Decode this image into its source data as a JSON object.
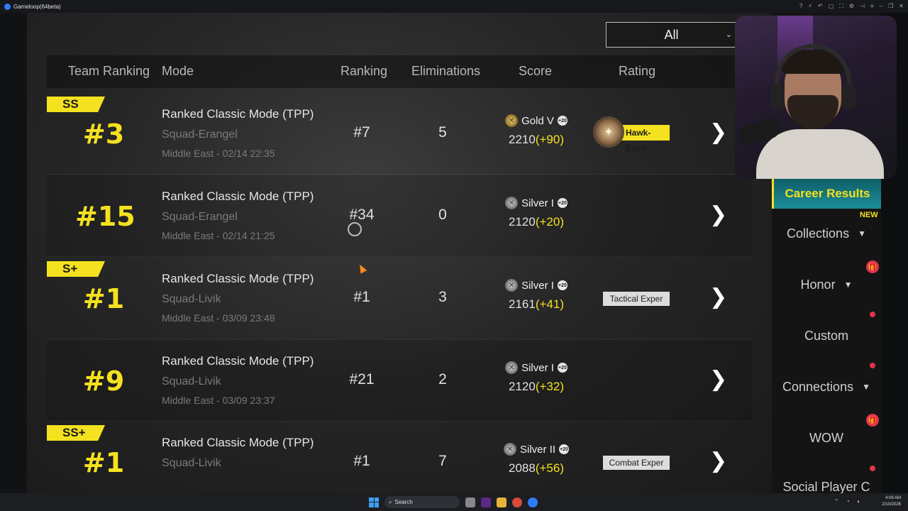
{
  "window": {
    "title": "Gameloop(64beta)"
  },
  "filter": {
    "label": "All"
  },
  "columns": [
    "Team Ranking",
    "Mode",
    "Ranking",
    "Eliminations",
    "Score",
    "Rating"
  ],
  "matches": [
    {
      "grade": "SS",
      "team_rank": "#3",
      "mode": "Ranked Classic Mode (TPP)",
      "map": "Squad-Erangel",
      "date": "Middle East - 02/14 22:35",
      "ranking": "#7",
      "elims": "5",
      "tier": "Gold V",
      "tier_plus": "+20",
      "score": "2210",
      "delta": "(+90)",
      "rating": "Hawk-Eyed",
      "rating_style": "gold"
    },
    {
      "grade": "",
      "team_rank": "#15",
      "mode": "Ranked Classic Mode (TPP)",
      "map": "Squad-Erangel",
      "date": "Middle East - 02/14 21:25",
      "ranking": "#34",
      "elims": "0",
      "tier": "Silver I",
      "tier_plus": "+20",
      "score": "2120",
      "delta": "(+20)",
      "rating": "",
      "rating_style": "none"
    },
    {
      "grade": "S+",
      "team_rank": "#1",
      "mode": "Ranked Classic Mode (TPP)",
      "map": "Squad-Livik",
      "date": "Middle East - 03/09 23:48",
      "ranking": "#1",
      "elims": "3",
      "tier": "Silver I",
      "tier_plus": "+20",
      "score": "2161",
      "delta": "(+41)",
      "rating": "Tactical Exper",
      "rating_style": "tag"
    },
    {
      "grade": "",
      "team_rank": "#9",
      "mode": "Ranked Classic Mode (TPP)",
      "map": "Squad-Livik",
      "date": "Middle East - 03/09 23:37",
      "ranking": "#21",
      "elims": "2",
      "tier": "Silver I",
      "tier_plus": "+20",
      "score": "2120",
      "delta": "(+32)",
      "rating": "",
      "rating_style": "none"
    },
    {
      "grade": "SS+",
      "team_rank": "#1",
      "mode": "Ranked Classic Mode (TPP)",
      "map": "Squad-Livik",
      "date": "",
      "ranking": "#1",
      "elims": "7",
      "tier": "Silver II",
      "tier_plus": "+20",
      "score": "2088",
      "delta": "(+56)",
      "rating": "Combat Exper",
      "rating_style": "tag"
    }
  ],
  "sidebar": {
    "active": "Career Results",
    "new_badge": "NEW",
    "items": [
      {
        "label": "Collections",
        "has_arrow": true
      },
      {
        "label": "Honor",
        "has_arrow": true
      },
      {
        "label": "Custom",
        "has_arrow": false
      },
      {
        "label": "Connections",
        "has_arrow": true
      },
      {
        "label": "WOW",
        "has_arrow": false
      },
      {
        "label": "Social Player C",
        "has_arrow": false
      }
    ]
  },
  "taskbar": {
    "search_label": "Search",
    "time": "4:06 AM",
    "date": "2/10/2026"
  },
  "colors": {
    "accent": "#f4e120",
    "panel": "#141414",
    "active_tab": "#1d8e97"
  }
}
